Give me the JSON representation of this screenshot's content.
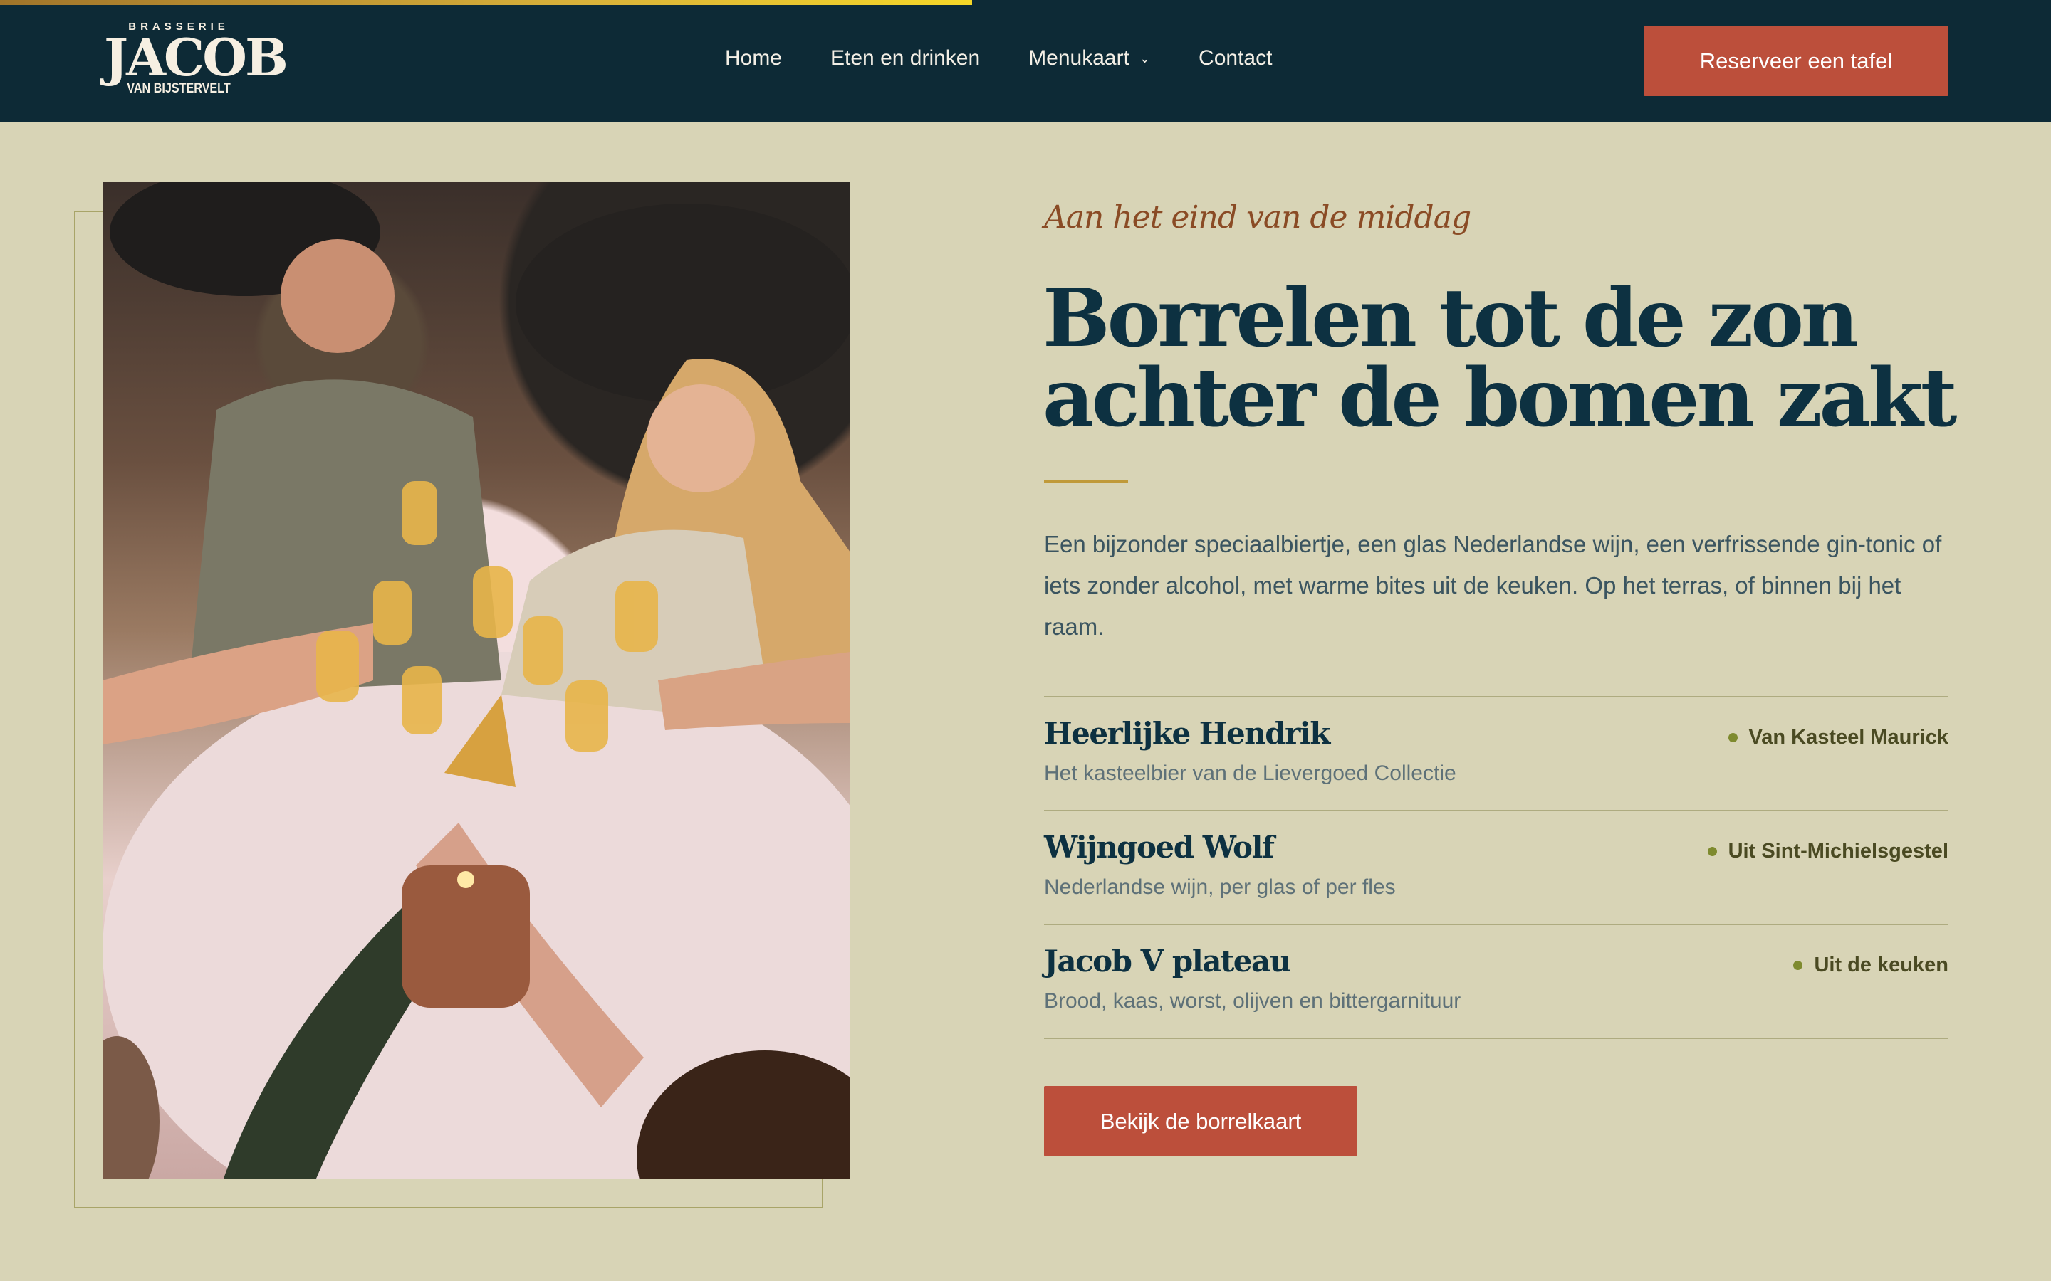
{
  "header": {
    "logo": {
      "top": "BRASSERIE",
      "main": "JACOB",
      "sub": "VAN BIJSTERVELT"
    },
    "nav": [
      {
        "label": "Home"
      },
      {
        "label": "Eten en drinken"
      },
      {
        "label": "Menukaart",
        "has_dropdown": true
      },
      {
        "label": "Contact"
      }
    ],
    "reserve_label": "Reserveer een tafel",
    "scroll_progress": 0.474
  },
  "hero": {
    "eyebrow": "Aan het eind van de middag",
    "headline_line1": "Borrelen tot de zon",
    "headline_line2": "achter de bomen zakt",
    "intro": "Een bijzonder speciaalbiertje, een glas Nederlandse wijn, een verfrissende gin-tonic of iets zonder alcohol, met warme bites uit de keuken. Op het terras, of binnen bij het raam.",
    "items": [
      {
        "name": "Heerlijke Hendrik",
        "desc": "Het kasteelbier van de Lievergoed Collectie",
        "tag": "Van Kasteel Maurick"
      },
      {
        "name": "Wijngoed Wolf",
        "desc": "Nederlandse wijn, per glas of per fles",
        "tag": "Uit Sint-Michielsgestel"
      },
      {
        "name": "Jacob V plateau",
        "desc": "Brood, kaas, worst, olijven en bittergarnituur",
        "tag": "Uit de keuken"
      }
    ],
    "cta_label": "Bekijk de borrelkaart"
  },
  "colors": {
    "header_bg": "#0d2a36",
    "page_bg": "#d8d4b6",
    "accent_button": "#bc4f3b",
    "headline": "#0d3141",
    "eyebrow": "#8a4b25",
    "tag_dot": "#7e8a2e"
  },
  "icons": {
    "menukaart_dropdown": "chevron-down-icon",
    "item_bullet": "dot-icon"
  }
}
